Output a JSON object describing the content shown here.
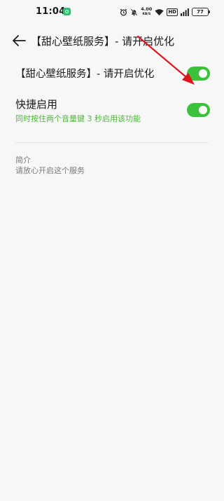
{
  "statusbar": {
    "time": "11:04",
    "net_speed": "4.00",
    "net_unit": "KB/S",
    "hd": "HD",
    "battery": "77"
  },
  "header": {
    "title": "【甜心壁纸服务】- 请开启优化"
  },
  "settings": {
    "service_label": "【甜心壁纸服务】- 请开启优化",
    "service_enabled": true,
    "shortcut_label": "快捷启用",
    "shortcut_desc": "同时按住两个音量键 3 秒启用该功能",
    "shortcut_enabled": true
  },
  "intro": {
    "title": "简介",
    "body": "请放心开启这个服务"
  },
  "colors": {
    "toggle_on": "#3cc23a",
    "annotation_arrow": "#e0141e",
    "accent_text": "#4fb83a"
  }
}
